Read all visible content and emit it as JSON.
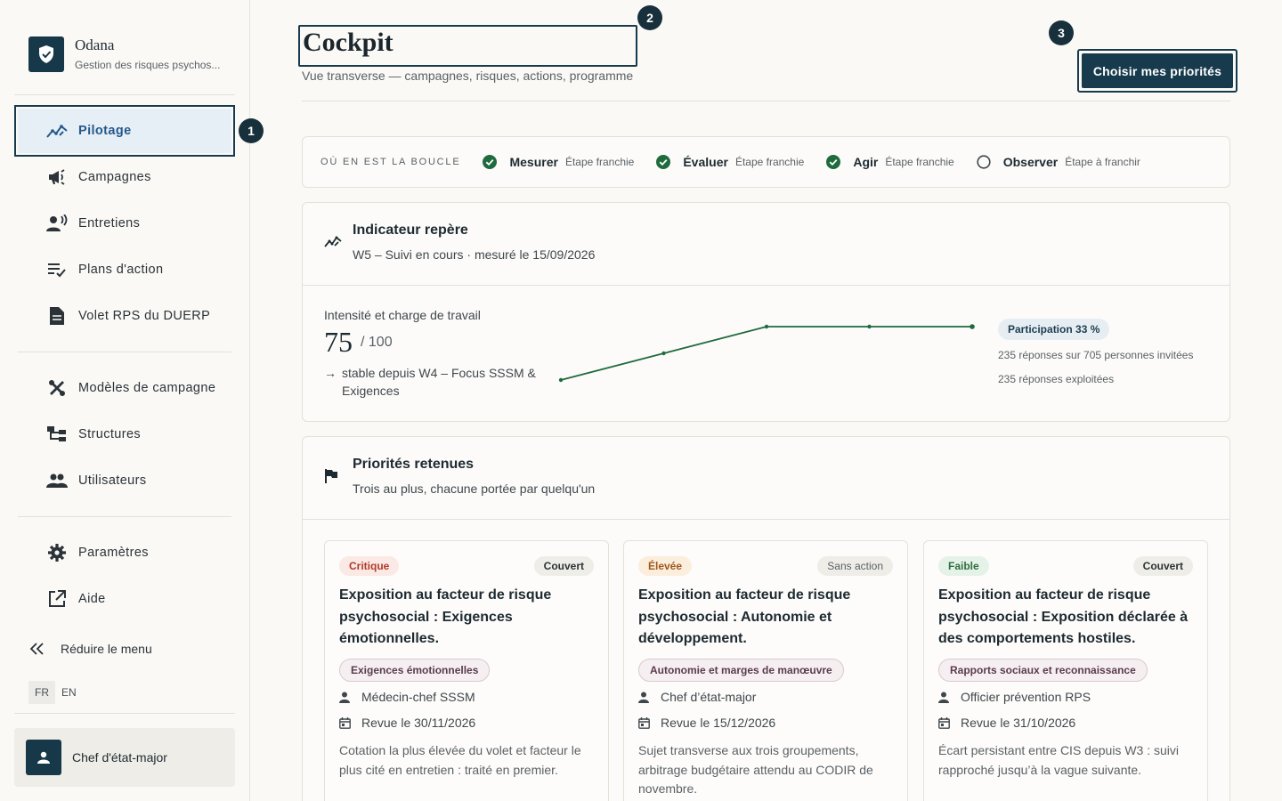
{
  "app": {
    "name": "Odana",
    "subtitle": "Gestion des risques psychos..."
  },
  "sidebar": {
    "items": [
      {
        "label": "Pilotage",
        "icon": "trend-chart-icon",
        "active": true
      },
      {
        "label": "Campagnes",
        "icon": "megaphone-icon"
      },
      {
        "label": "Entretiens",
        "icon": "person-voice-icon"
      },
      {
        "label": "Plans d'action",
        "icon": "checklist-icon"
      },
      {
        "label": "Volet RPS du DUERP",
        "icon": "document-icon"
      },
      {
        "label": "Modèles de campagne",
        "icon": "tools-icon"
      },
      {
        "label": "Structures",
        "icon": "hierarchy-icon"
      },
      {
        "label": "Utilisateurs",
        "icon": "group-icon"
      },
      {
        "label": "Paramètres",
        "icon": "gear-icon"
      },
      {
        "label": "Aide",
        "icon": "external-link-icon"
      }
    ],
    "collapse_label": "Réduire le menu",
    "languages": [
      "FR",
      "EN"
    ],
    "user": "Chef d'état-major"
  },
  "tour": [
    "1",
    "2",
    "3"
  ],
  "header": {
    "title": "Cockpit",
    "subtitle": "Vue transverse — campagnes, risques, actions, programme",
    "cta": "Choisir mes priorités"
  },
  "loop": {
    "label": "OÙ EN EST LA BOUCLE",
    "steps": [
      {
        "name": "Mesurer",
        "state": "Étape franchie",
        "done": true
      },
      {
        "name": "Évaluer",
        "state": "Étape franchie",
        "done": true
      },
      {
        "name": "Agir",
        "state": "Étape franchie",
        "done": true
      },
      {
        "name": "Observer",
        "state": "Étape à franchir",
        "done": false
      }
    ]
  },
  "indicator": {
    "title": "Indicateur repère",
    "subtitle": "W5 – Suivi en cours · mesuré le 15/09/2026",
    "metric_label": "Intensité et charge de travail",
    "value": "75",
    "unit": "/ 100",
    "trend_arrow": "→",
    "trend": "stable depuis W4 – Focus SSSM & Exigences",
    "series": [
      61,
      68,
      75,
      75,
      75
    ],
    "participation": "Participation 33 %",
    "responses": "235 réponses sur 705 personnes invitées",
    "exploited": "235 réponses exploitées",
    "color": "#1f6b3e"
  },
  "priorities": {
    "title": "Priorités retenues",
    "subtitle": "Trois au plus, chacune portée par quelqu'un",
    "cards": [
      {
        "severity": "Critique",
        "status": "Couvert",
        "title": "Exposition au facteur de risque psychosocial : Exigences émotionnelles.",
        "tag": "Exigences émotionnelles",
        "owner": "Médecin-chef SSSM",
        "review": "Revue le 30/11/2026",
        "desc": "Cotation la plus élevée du volet et facteur le plus cité en entretien : traité en premier."
      },
      {
        "severity": "Élevée",
        "status": "Sans action",
        "title": "Exposition au facteur de risque psychosocial : Autonomie et développement.",
        "tag": "Autonomie et marges de manœuvre",
        "owner": "Chef d’état-major",
        "review": "Revue le 15/12/2026",
        "desc": "Sujet transverse aux trois groupements, arbitrage budgétaire attendu au CODIR de novembre."
      },
      {
        "severity": "Faible",
        "status": "Couvert",
        "title": "Exposition au facteur de risque psychosocial : Exposition déclarée à des comportements hostiles.",
        "tag": "Rapports sociaux et reconnaissance",
        "owner": "Officier prévention RPS",
        "review": "Revue le 31/10/2026",
        "desc": "Écart persistant entre CIS depuis W3 : suivi rapproché jusqu’à la vague suivante."
      }
    ]
  }
}
